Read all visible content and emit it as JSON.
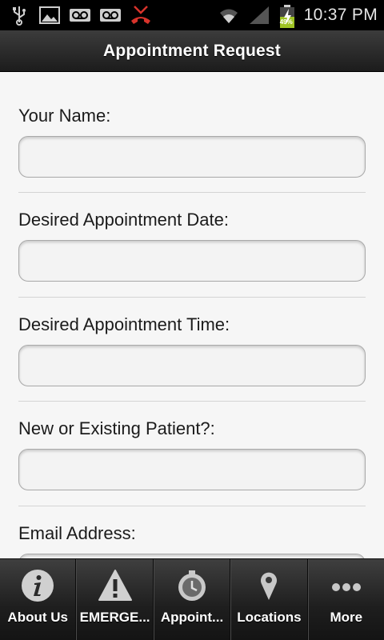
{
  "status_bar": {
    "time": "10:37 PM",
    "battery_percent": "49%",
    "icons": [
      "usb-icon",
      "image-icon",
      "voicemail-icon",
      "voicemail-icon",
      "missed-call-icon",
      "wifi-icon",
      "signal-icon",
      "battery-charging-icon"
    ]
  },
  "header": {
    "title": "Appointment Request"
  },
  "form": {
    "fields": [
      {
        "label": "Your Name:",
        "value": ""
      },
      {
        "label": "Desired Appointment Date:",
        "value": ""
      },
      {
        "label": "Desired Appointment Time:",
        "value": ""
      },
      {
        "label": "New or Existing Patient?:",
        "value": ""
      },
      {
        "label": "Email Address:",
        "value": ""
      }
    ]
  },
  "tabbar": {
    "tabs": [
      {
        "label": "About Us",
        "icon": "info-icon"
      },
      {
        "label": "EMERGE...",
        "icon": "warning-icon"
      },
      {
        "label": "Appoint...",
        "icon": "clock-icon"
      },
      {
        "label": "Locations",
        "icon": "map-pin-icon"
      },
      {
        "label": "More",
        "icon": "more-icon"
      }
    ]
  },
  "colors": {
    "title_bar": "#2a2a2a",
    "tab_bar": "#1e1e1e",
    "page_bg": "#f6f6f6",
    "label_text": "#1b1b1b",
    "charging_green": "#9ec324",
    "missed_call_red": "#d8332b"
  }
}
